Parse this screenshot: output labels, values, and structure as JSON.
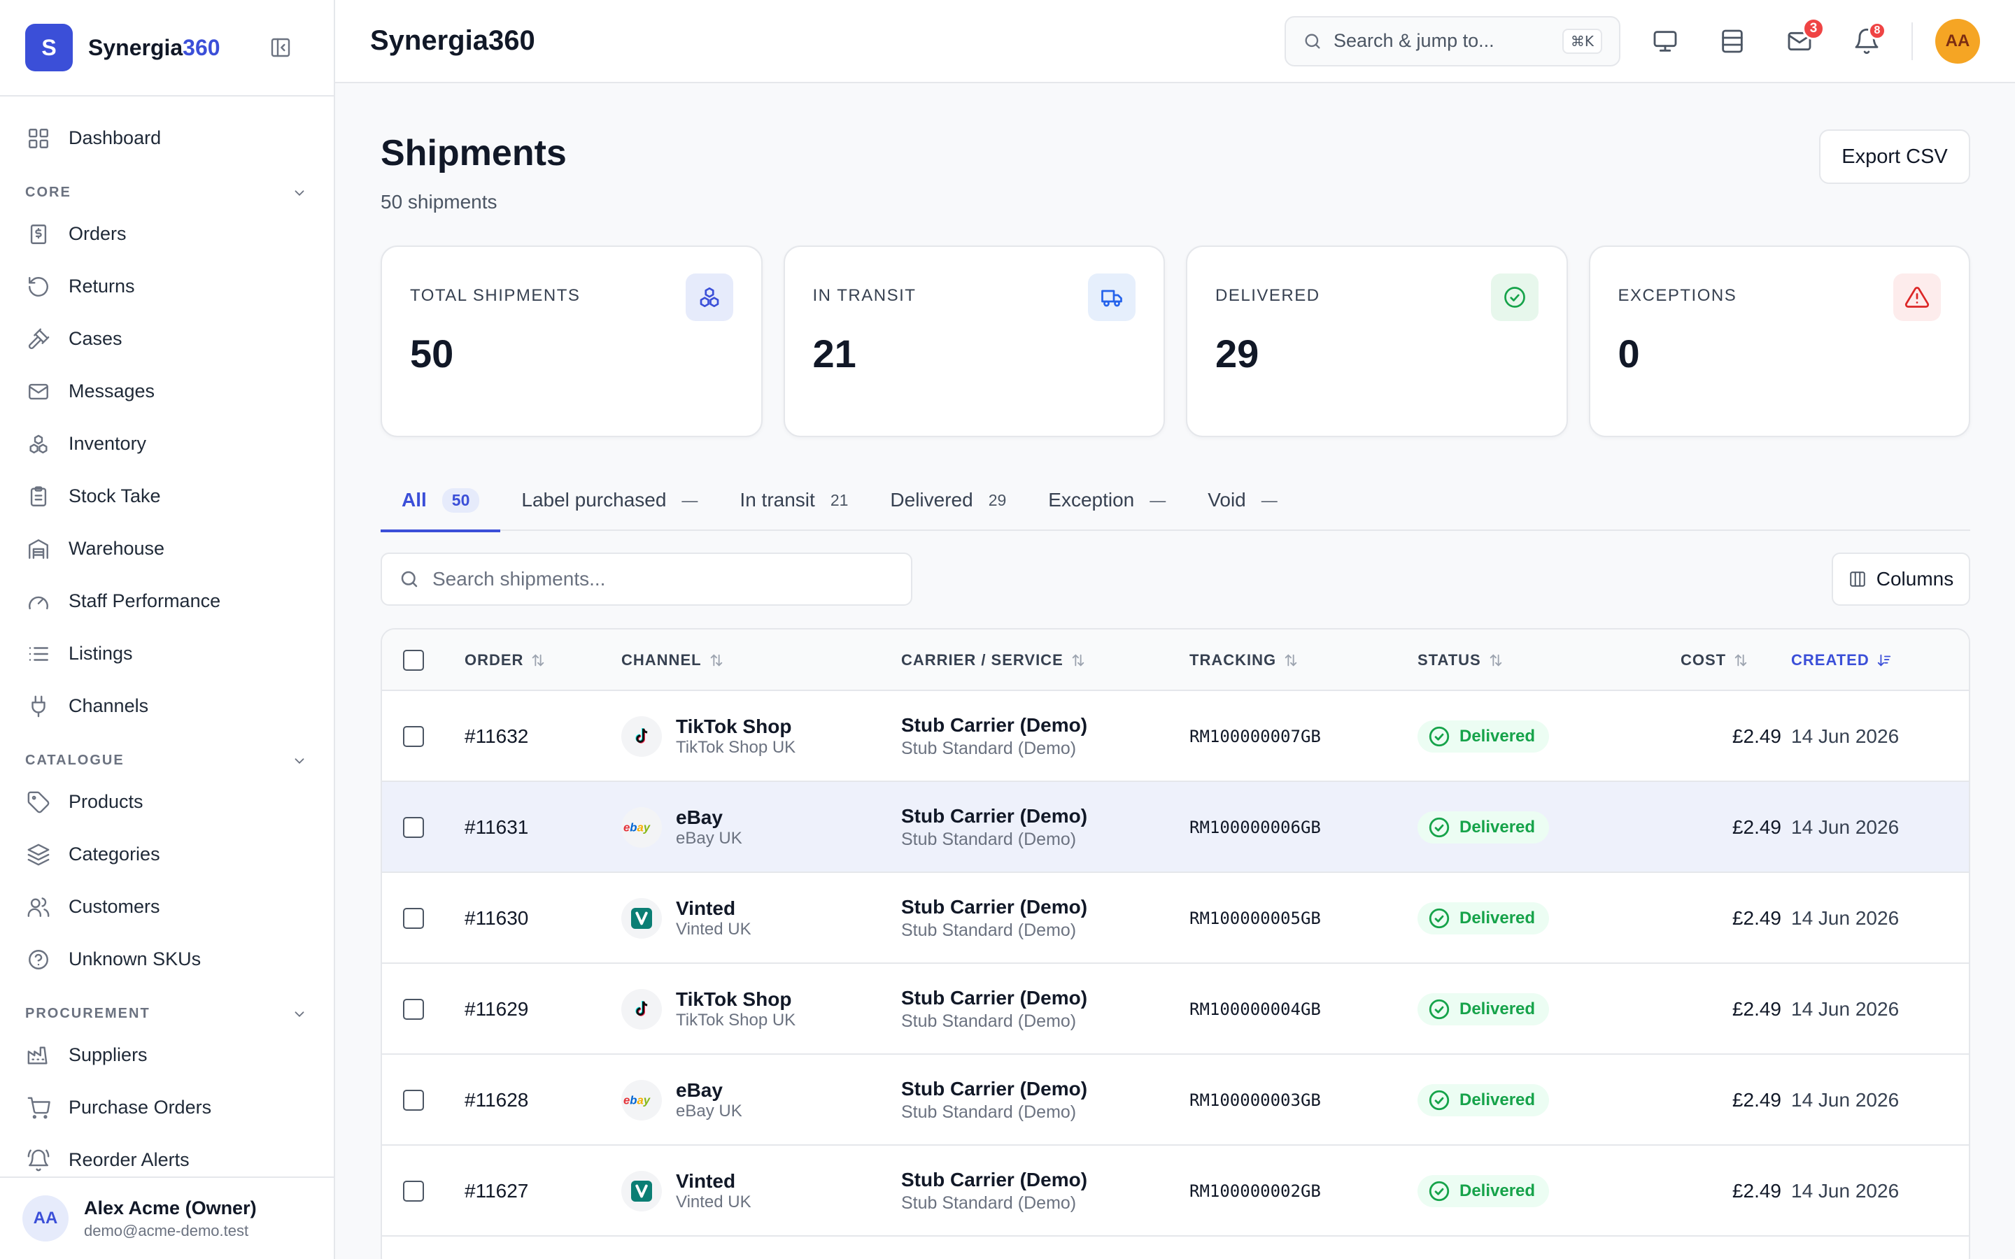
{
  "brand": {
    "logo_letter": "S",
    "name_main": "Synergia",
    "name_accent": "360"
  },
  "sidebar": {
    "top_items": [
      {
        "label": "Dashboard",
        "icon": "grid-icon"
      }
    ],
    "sections": [
      {
        "title": "CORE",
        "items": [
          {
            "label": "Orders",
            "icon": "receipt-icon"
          },
          {
            "label": "Returns",
            "icon": "rotate-ccw-icon"
          },
          {
            "label": "Cases",
            "icon": "gavel-icon"
          },
          {
            "label": "Messages",
            "icon": "mail-icon"
          },
          {
            "label": "Inventory",
            "icon": "boxes-icon"
          },
          {
            "label": "Stock Take",
            "icon": "clipboard-icon"
          },
          {
            "label": "Warehouse",
            "icon": "warehouse-icon"
          },
          {
            "label": "Staff Performance",
            "icon": "gauge-icon"
          },
          {
            "label": "Listings",
            "icon": "list-icon"
          },
          {
            "label": "Channels",
            "icon": "plug-icon"
          }
        ]
      },
      {
        "title": "CATALOGUE",
        "items": [
          {
            "label": "Products",
            "icon": "tag-icon"
          },
          {
            "label": "Categories",
            "icon": "layers-icon"
          },
          {
            "label": "Customers",
            "icon": "users-icon"
          },
          {
            "label": "Unknown SKUs",
            "icon": "help-circle-icon"
          }
        ]
      },
      {
        "title": "PROCUREMENT",
        "items": [
          {
            "label": "Suppliers",
            "icon": "factory-icon"
          },
          {
            "label": "Purchase Orders",
            "icon": "cart-icon"
          },
          {
            "label": "Reorder Alerts",
            "icon": "bell-ring-icon"
          }
        ]
      }
    ],
    "user": {
      "initials": "AA",
      "name": "Alex Acme (Owner)",
      "email": "demo@acme-demo.test"
    }
  },
  "topbar": {
    "title": "Synergia360",
    "search_placeholder": "Search & jump to...",
    "search_shortcut": "⌘K",
    "mail_badge": "3",
    "bell_badge": "8",
    "avatar_initials": "AA"
  },
  "page": {
    "title": "Shipments",
    "subtitle": "50 shipments",
    "export_label": "Export CSV"
  },
  "stats": [
    {
      "label": "TOTAL SHIPMENTS",
      "value": "50",
      "icon": "boxes-icon",
      "color": "#3b4fd8",
      "bg": "#e6ebfb"
    },
    {
      "label": "IN TRANSIT",
      "value": "21",
      "icon": "truck-icon",
      "color": "#2563eb",
      "bg": "#e6effc"
    },
    {
      "label": "DELIVERED",
      "value": "29",
      "icon": "check-circle-icon",
      "color": "#16a34a",
      "bg": "#e7f7ec"
    },
    {
      "label": "EXCEPTIONS",
      "value": "0",
      "icon": "alert-triangle-icon",
      "color": "#dc2626",
      "bg": "#fdecec"
    }
  ],
  "tabs": [
    {
      "label": "All",
      "count": "50",
      "active": true
    },
    {
      "label": "Label purchased",
      "count": "—"
    },
    {
      "label": "In transit",
      "count": "21"
    },
    {
      "label": "Delivered",
      "count": "29"
    },
    {
      "label": "Exception",
      "count": "—"
    },
    {
      "label": "Void",
      "count": "—"
    }
  ],
  "table": {
    "search_placeholder": "Search shipments...",
    "columns_label": "Columns",
    "headers": {
      "order": "ORDER",
      "channel": "CHANNEL",
      "carrier": "CARRIER / SERVICE",
      "tracking": "TRACKING",
      "status": "STATUS",
      "cost": "COST",
      "created": "CREATED"
    },
    "rows": [
      {
        "order": "#11632",
        "channel": "TikTok Shop",
        "channel_sub": "TikTok Shop UK",
        "channel_icon": "tiktok-icon",
        "carrier": "Stub Carrier (Demo)",
        "service": "Stub Standard (Demo)",
        "tracking": "RM100000007GB",
        "status": "Delivered",
        "cost": "£2.49",
        "created": "14 Jun 2026"
      },
      {
        "order": "#11631",
        "channel": "eBay",
        "channel_sub": "eBay UK",
        "channel_icon": "ebay-icon",
        "carrier": "Stub Carrier (Demo)",
        "service": "Stub Standard (Demo)",
        "tracking": "RM100000006GB",
        "status": "Delivered",
        "cost": "£2.49",
        "created": "14 Jun 2026"
      },
      {
        "order": "#11630",
        "channel": "Vinted",
        "channel_sub": "Vinted UK",
        "channel_icon": "vinted-icon",
        "carrier": "Stub Carrier (Demo)",
        "service": "Stub Standard (Demo)",
        "tracking": "RM100000005GB",
        "status": "Delivered",
        "cost": "£2.49",
        "created": "14 Jun 2026"
      },
      {
        "order": "#11629",
        "channel": "TikTok Shop",
        "channel_sub": "TikTok Shop UK",
        "channel_icon": "tiktok-icon",
        "carrier": "Stub Carrier (Demo)",
        "service": "Stub Standard (Demo)",
        "tracking": "RM100000004GB",
        "status": "Delivered",
        "cost": "£2.49",
        "created": "14 Jun 2026"
      },
      {
        "order": "#11628",
        "channel": "eBay",
        "channel_sub": "eBay UK",
        "channel_icon": "ebay-icon",
        "carrier": "Stub Carrier (Demo)",
        "service": "Stub Standard (Demo)",
        "tracking": "RM100000003GB",
        "status": "Delivered",
        "cost": "£2.49",
        "created": "14 Jun 2026"
      },
      {
        "order": "#11627",
        "channel": "Vinted",
        "channel_sub": "Vinted UK",
        "channel_icon": "vinted-icon",
        "carrier": "Stub Carrier (Demo)",
        "service": "Stub Standard (Demo)",
        "tracking": "RM100000002GB",
        "status": "Delivered",
        "cost": "£2.49",
        "created": "14 Jun 2026"
      }
    ]
  },
  "colors": {
    "accent": "#3b4fd8",
    "success": "#16a34a",
    "danger": "#ef4444"
  }
}
